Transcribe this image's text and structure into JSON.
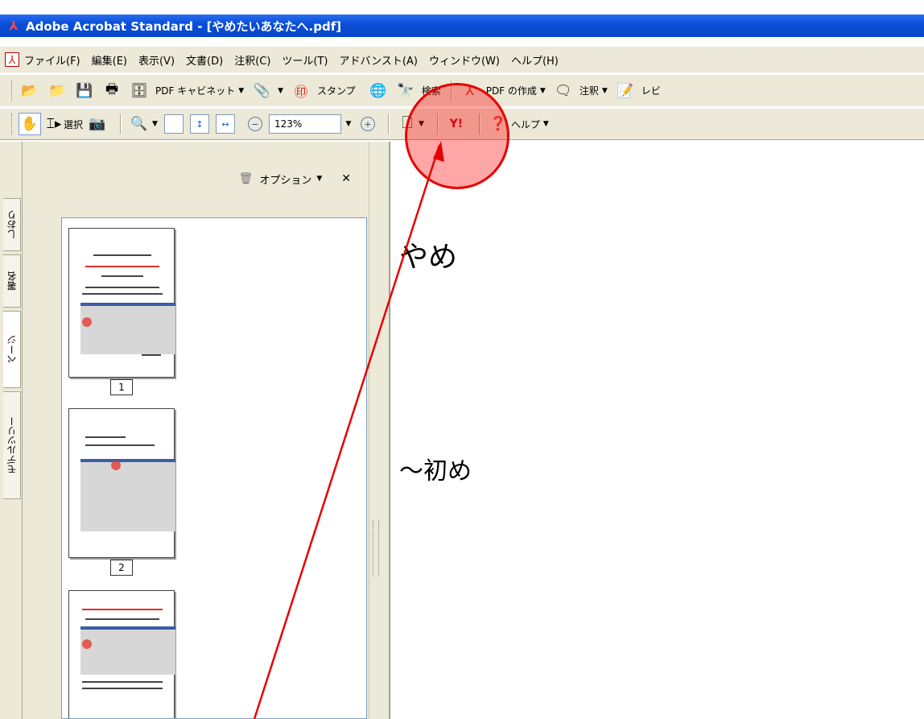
{
  "window": {
    "title": "Adobe Acrobat Standard - [やめたいあなたへ.pdf]"
  },
  "menubar": {
    "items": [
      "ファイル(F)",
      "編集(E)",
      "表示(V)",
      "文書(D)",
      "注釈(C)",
      "ツール(T)",
      "アドバンスト(A)",
      "ウィンドウ(W)",
      "ヘルプ(H)"
    ]
  },
  "toolbar1": {
    "pdf_cabinet": "PDF キャビネット",
    "stamp": "スタンプ",
    "search": "検索",
    "create_pdf": "PDF の作成",
    "annotate": "注釈",
    "review": "レビ"
  },
  "toolbar2": {
    "select": "選択",
    "zoom_value": "123%",
    "help": "ヘルプ"
  },
  "left_tabs": [
    "しおり",
    "署名",
    "ページ",
    "モデルツリー"
  ],
  "nav_panel": {
    "options_label": "オプション",
    "pages": [
      "1",
      "2"
    ]
  },
  "document": {
    "title_fragment": "やめ",
    "subtitle_fragment": "～初め"
  },
  "colors": {
    "titlebar": "#0a4fd8",
    "chrome": "#ece9d8",
    "annotation_red": "#e80000"
  },
  "icons": {
    "app": "acrobat-icon",
    "open": "folder-open-icon",
    "save": "save-icon",
    "print": "print-icon",
    "hand": "hand-icon",
    "zoom": "zoom-in-icon",
    "help": "help-icon"
  }
}
